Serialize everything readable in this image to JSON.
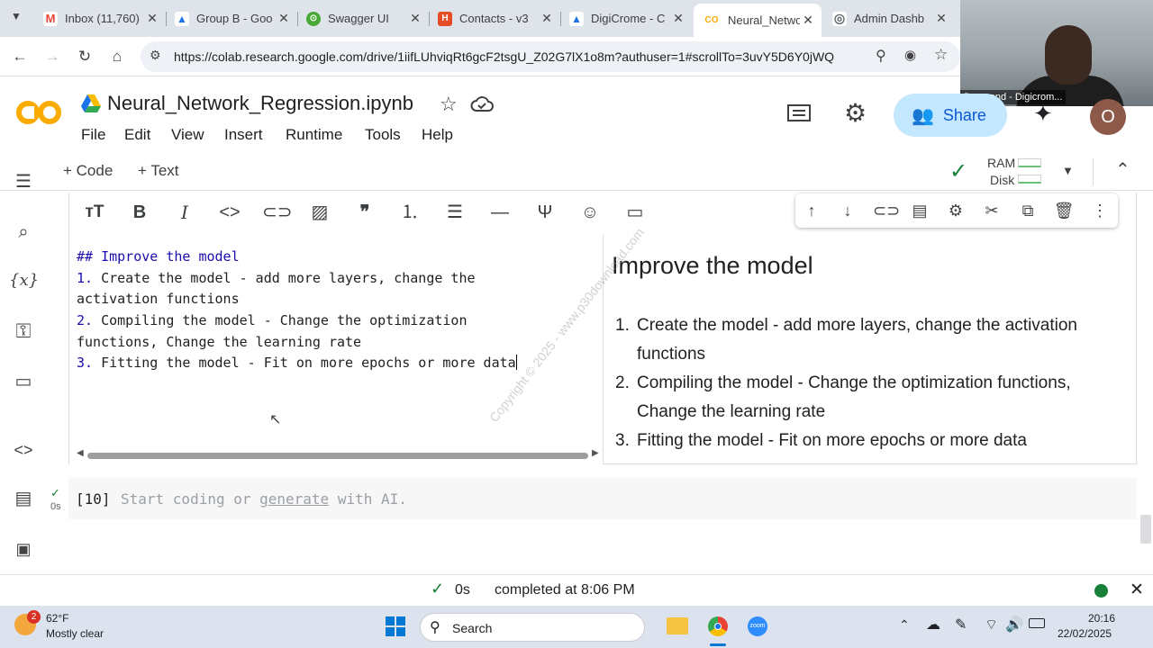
{
  "tabs": [
    {
      "title": "Inbox (11,760)",
      "color": "#ea4335",
      "glyph": "M"
    },
    {
      "title": "Group B - Goo",
      "color": "#1a73e8",
      "glyph": "▲"
    },
    {
      "title": "Swagger UI",
      "color": "#49a936",
      "glyph": "⊙"
    },
    {
      "title": "Contacts - v3",
      "color": "#e44d26",
      "glyph": "H"
    },
    {
      "title": "DigiCrome - C",
      "color": "#1a73e8",
      "glyph": "▲"
    },
    {
      "title": "Neural_Netwo",
      "color": "#f9ab00",
      "glyph": "CO"
    },
    {
      "title": "Admin Dashb",
      "color": "#5f6368",
      "glyph": "◎"
    }
  ],
  "address": {
    "url": "https://colab.research.google.com/drive/1iifLUhviqRt6gcF2tsgU_Z02G7lX1o8m?authuser=1#scrollTo=3uvY5D6Y0jWQ"
  },
  "webcam": {
    "name": "Desmond - Digicrom..."
  },
  "notebook": {
    "title": "Neural_Network_Regression.ipynb"
  },
  "menu": [
    "File",
    "Edit",
    "View",
    "Insert",
    "Runtime",
    "Tools",
    "Help"
  ],
  "header": {
    "share_label": "Share",
    "avatar_letter": "O"
  },
  "toolbar": {
    "code_label": "+ Code",
    "text_label": "+ Text",
    "ram_label": "RAM",
    "disk_label": "Disk"
  },
  "cell": {
    "editor_lines": [
      {
        "prefix": "##",
        "text": " Improve the model"
      },
      {
        "prefix": "1.",
        "text": " Create the model - add more layers, change the"
      },
      {
        "prefix": "",
        "text": "activation functions"
      },
      {
        "prefix": "2.",
        "text": " Compiling the model - Change the optimization"
      },
      {
        "prefix": "",
        "text": "functions, Change the learning rate"
      },
      {
        "prefix": "3.",
        "text": " Fitting the model - Fit on more epochs or more data"
      }
    ],
    "preview_heading": "Improve the model",
    "preview_items": [
      {
        "num": "1.",
        "text": "Create the model - add more layers, change the activation functions"
      },
      {
        "num": "2.",
        "text": "Compiling the model - Change the optimization functions, Change the learning rate"
      },
      {
        "num": "3.",
        "text": "Fitting the model - Fit on more epochs or more data"
      }
    ]
  },
  "watermark": "Copyright © 2025 - www.p30download.com",
  "code_cell": {
    "exec_count": "[10]",
    "runtime": "0s",
    "placeholder_pre": "Start coding or ",
    "placeholder_link": "generate",
    "placeholder_post": " with AI."
  },
  "status": {
    "time": "0s",
    "completed": "completed at 8:06 PM"
  },
  "taskbar": {
    "temp": "62°F",
    "weather": "Mostly clear",
    "weather_badge": "2",
    "search": "Search",
    "clock_time": "20:16",
    "clock_date": "22/02/2025"
  },
  "colors": {
    "accent": "#0b57d0",
    "share_bg": "#c2e7ff",
    "green": "#188038"
  }
}
